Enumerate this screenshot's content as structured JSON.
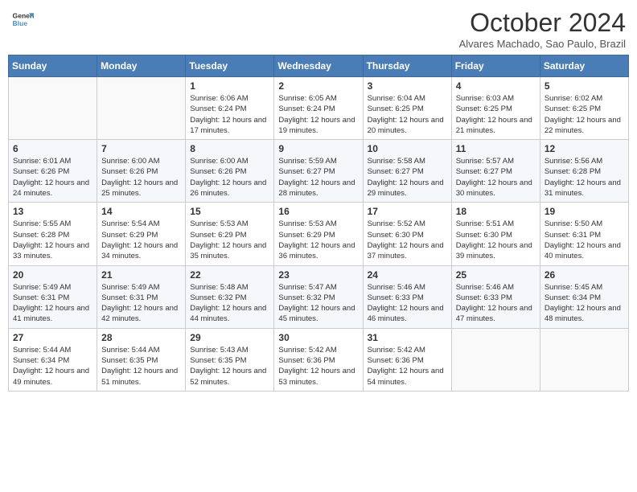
{
  "logo": {
    "line1": "General",
    "line2": "Blue"
  },
  "title": "October 2024",
  "subtitle": "Alvares Machado, Sao Paulo, Brazil",
  "weekdays": [
    "Sunday",
    "Monday",
    "Tuesday",
    "Wednesday",
    "Thursday",
    "Friday",
    "Saturday"
  ],
  "weeks": [
    [
      {
        "day": "",
        "info": ""
      },
      {
        "day": "",
        "info": ""
      },
      {
        "day": "1",
        "info": "Sunrise: 6:06 AM\nSunset: 6:24 PM\nDaylight: 12 hours and 17 minutes."
      },
      {
        "day": "2",
        "info": "Sunrise: 6:05 AM\nSunset: 6:24 PM\nDaylight: 12 hours and 19 minutes."
      },
      {
        "day": "3",
        "info": "Sunrise: 6:04 AM\nSunset: 6:25 PM\nDaylight: 12 hours and 20 minutes."
      },
      {
        "day": "4",
        "info": "Sunrise: 6:03 AM\nSunset: 6:25 PM\nDaylight: 12 hours and 21 minutes."
      },
      {
        "day": "5",
        "info": "Sunrise: 6:02 AM\nSunset: 6:25 PM\nDaylight: 12 hours and 22 minutes."
      }
    ],
    [
      {
        "day": "6",
        "info": "Sunrise: 6:01 AM\nSunset: 6:26 PM\nDaylight: 12 hours and 24 minutes."
      },
      {
        "day": "7",
        "info": "Sunrise: 6:00 AM\nSunset: 6:26 PM\nDaylight: 12 hours and 25 minutes."
      },
      {
        "day": "8",
        "info": "Sunrise: 6:00 AM\nSunset: 6:26 PM\nDaylight: 12 hours and 26 minutes."
      },
      {
        "day": "9",
        "info": "Sunrise: 5:59 AM\nSunset: 6:27 PM\nDaylight: 12 hours and 28 minutes."
      },
      {
        "day": "10",
        "info": "Sunrise: 5:58 AM\nSunset: 6:27 PM\nDaylight: 12 hours and 29 minutes."
      },
      {
        "day": "11",
        "info": "Sunrise: 5:57 AM\nSunset: 6:27 PM\nDaylight: 12 hours and 30 minutes."
      },
      {
        "day": "12",
        "info": "Sunrise: 5:56 AM\nSunset: 6:28 PM\nDaylight: 12 hours and 31 minutes."
      }
    ],
    [
      {
        "day": "13",
        "info": "Sunrise: 5:55 AM\nSunset: 6:28 PM\nDaylight: 12 hours and 33 minutes."
      },
      {
        "day": "14",
        "info": "Sunrise: 5:54 AM\nSunset: 6:29 PM\nDaylight: 12 hours and 34 minutes."
      },
      {
        "day": "15",
        "info": "Sunrise: 5:53 AM\nSunset: 6:29 PM\nDaylight: 12 hours and 35 minutes."
      },
      {
        "day": "16",
        "info": "Sunrise: 5:53 AM\nSunset: 6:29 PM\nDaylight: 12 hours and 36 minutes."
      },
      {
        "day": "17",
        "info": "Sunrise: 5:52 AM\nSunset: 6:30 PM\nDaylight: 12 hours and 37 minutes."
      },
      {
        "day": "18",
        "info": "Sunrise: 5:51 AM\nSunset: 6:30 PM\nDaylight: 12 hours and 39 minutes."
      },
      {
        "day": "19",
        "info": "Sunrise: 5:50 AM\nSunset: 6:31 PM\nDaylight: 12 hours and 40 minutes."
      }
    ],
    [
      {
        "day": "20",
        "info": "Sunrise: 5:49 AM\nSunset: 6:31 PM\nDaylight: 12 hours and 41 minutes."
      },
      {
        "day": "21",
        "info": "Sunrise: 5:49 AM\nSunset: 6:31 PM\nDaylight: 12 hours and 42 minutes."
      },
      {
        "day": "22",
        "info": "Sunrise: 5:48 AM\nSunset: 6:32 PM\nDaylight: 12 hours and 44 minutes."
      },
      {
        "day": "23",
        "info": "Sunrise: 5:47 AM\nSunset: 6:32 PM\nDaylight: 12 hours and 45 minutes."
      },
      {
        "day": "24",
        "info": "Sunrise: 5:46 AM\nSunset: 6:33 PM\nDaylight: 12 hours and 46 minutes."
      },
      {
        "day": "25",
        "info": "Sunrise: 5:46 AM\nSunset: 6:33 PM\nDaylight: 12 hours and 47 minutes."
      },
      {
        "day": "26",
        "info": "Sunrise: 5:45 AM\nSunset: 6:34 PM\nDaylight: 12 hours and 48 minutes."
      }
    ],
    [
      {
        "day": "27",
        "info": "Sunrise: 5:44 AM\nSunset: 6:34 PM\nDaylight: 12 hours and 49 minutes."
      },
      {
        "day": "28",
        "info": "Sunrise: 5:44 AM\nSunset: 6:35 PM\nDaylight: 12 hours and 51 minutes."
      },
      {
        "day": "29",
        "info": "Sunrise: 5:43 AM\nSunset: 6:35 PM\nDaylight: 12 hours and 52 minutes."
      },
      {
        "day": "30",
        "info": "Sunrise: 5:42 AM\nSunset: 6:36 PM\nDaylight: 12 hours and 53 minutes."
      },
      {
        "day": "31",
        "info": "Sunrise: 5:42 AM\nSunset: 6:36 PM\nDaylight: 12 hours and 54 minutes."
      },
      {
        "day": "",
        "info": ""
      },
      {
        "day": "",
        "info": ""
      }
    ]
  ]
}
